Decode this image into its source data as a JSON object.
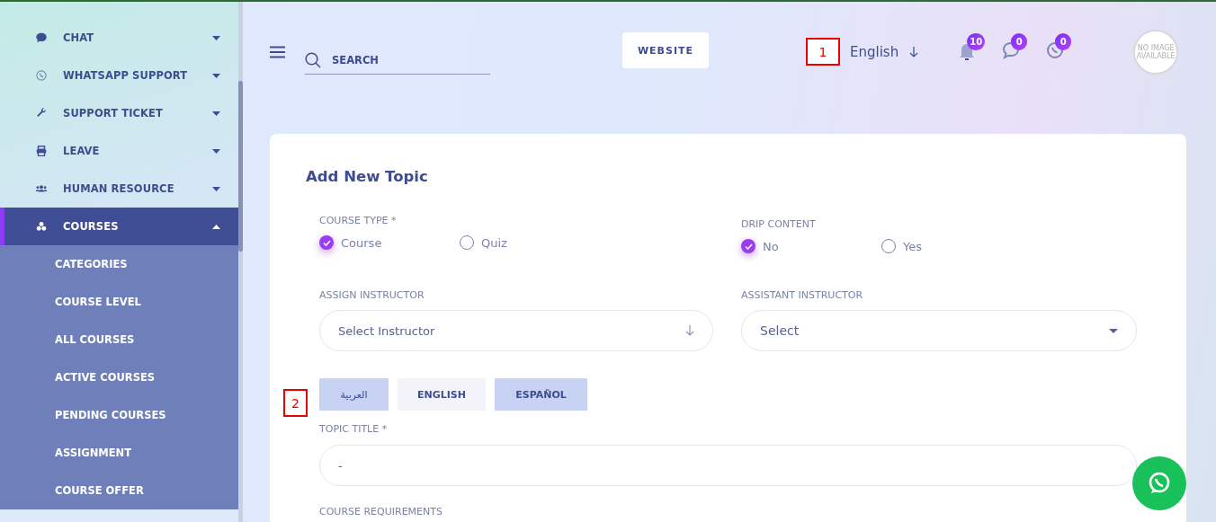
{
  "sidebar": {
    "items": [
      {
        "label": "CHAT",
        "expanded": false,
        "selected": false
      },
      {
        "label": "WHATSAPP SUPPORT",
        "expanded": false,
        "selected": false
      },
      {
        "label": "SUPPORT TICKET",
        "expanded": false,
        "selected": false
      },
      {
        "label": "LEAVE",
        "expanded": false,
        "selected": false
      },
      {
        "label": "HUMAN RESOURCE",
        "expanded": false,
        "selected": false
      },
      {
        "label": "COURSES",
        "expanded": true,
        "selected": true,
        "children": [
          {
            "label": "CATEGORIES"
          },
          {
            "label": "COURSE LEVEL"
          },
          {
            "label": "ALL COURSES"
          },
          {
            "label": "ACTIVE COURSES"
          },
          {
            "label": "PENDING COURSES"
          },
          {
            "label": "ASSIGNMENT"
          },
          {
            "label": "COURSE OFFER"
          }
        ]
      }
    ]
  },
  "header": {
    "search": {
      "placeholder": "SEARCH"
    },
    "website_button": "WEBSITE",
    "language": "English",
    "notifications": [
      {
        "count": "10"
      },
      {
        "count": "0"
      },
      {
        "count": "0"
      }
    ],
    "avatar": "NO IMAGE AVAILABLE"
  },
  "form": {
    "title": "Add New Topic",
    "course_type": {
      "label": "COURSE TYPE *",
      "options": [
        {
          "label": "Course",
          "selected": true
        },
        {
          "label": "Quiz",
          "selected": false
        }
      ]
    },
    "drip_content": {
      "label": "DRIP CONTENT",
      "options": [
        {
          "label": "No",
          "selected": true
        },
        {
          "label": "Yes",
          "selected": false
        }
      ]
    },
    "assign_instructor": {
      "label": "ASSIGN INSTRUCTOR",
      "value": "Select Instructor"
    },
    "assistant_instructor": {
      "label": "ASSISTANT INSTRUCTOR",
      "value": "Select"
    },
    "language_tabs": [
      {
        "label": "العربية",
        "selected": false
      },
      {
        "label": "ENGLISH",
        "selected": true
      },
      {
        "label": "ESPAÑOL",
        "selected": false
      }
    ],
    "topic_title": {
      "label": "TOPIC TITLE *",
      "value": "-"
    },
    "course_requirements": {
      "label": "COURSE REQUIREMENTS"
    }
  },
  "annotations": [
    {
      "label": "1"
    },
    {
      "label": "2"
    }
  ]
}
